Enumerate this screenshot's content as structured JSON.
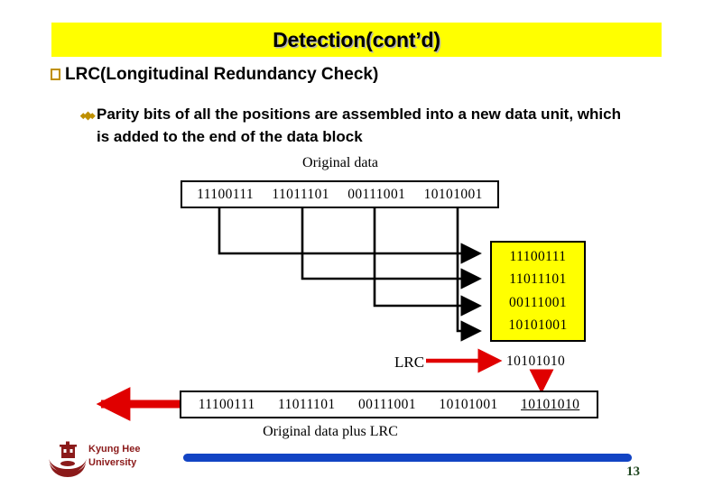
{
  "slide": {
    "title": "Detection(cont’d)",
    "page_number": "13",
    "title_bg_color": "#ffff00",
    "bullet_color": "#bf9000",
    "accent_red": "#e00000",
    "footer_bar_color": "#1244c4"
  },
  "bullets": [
    {
      "marker": "hollow-square-bullet",
      "text": "LRC(Longitudinal Redundancy Check)"
    },
    {
      "marker": "diamond-cluster-bullet",
      "text": "Parity bits of all the positions are assembled into a new data unit, which is added to the end of the data block"
    }
  ],
  "diagram": {
    "original_data_label": "Original data",
    "original_data_values": [
      "11100111",
      "11011101",
      "00111001",
      "10101001"
    ],
    "stacked_values": [
      "11100111",
      "11011101",
      "00111001",
      "10101001"
    ],
    "lrc_label": "LRC",
    "lrc_value": "10101010",
    "result_label": "Original data plus LRC",
    "result_values": [
      "11100111",
      "11011101",
      "00111001",
      "10101001",
      "10101010"
    ]
  },
  "footer": {
    "university_line1": "Kyung Hee",
    "university_line2": "University"
  }
}
